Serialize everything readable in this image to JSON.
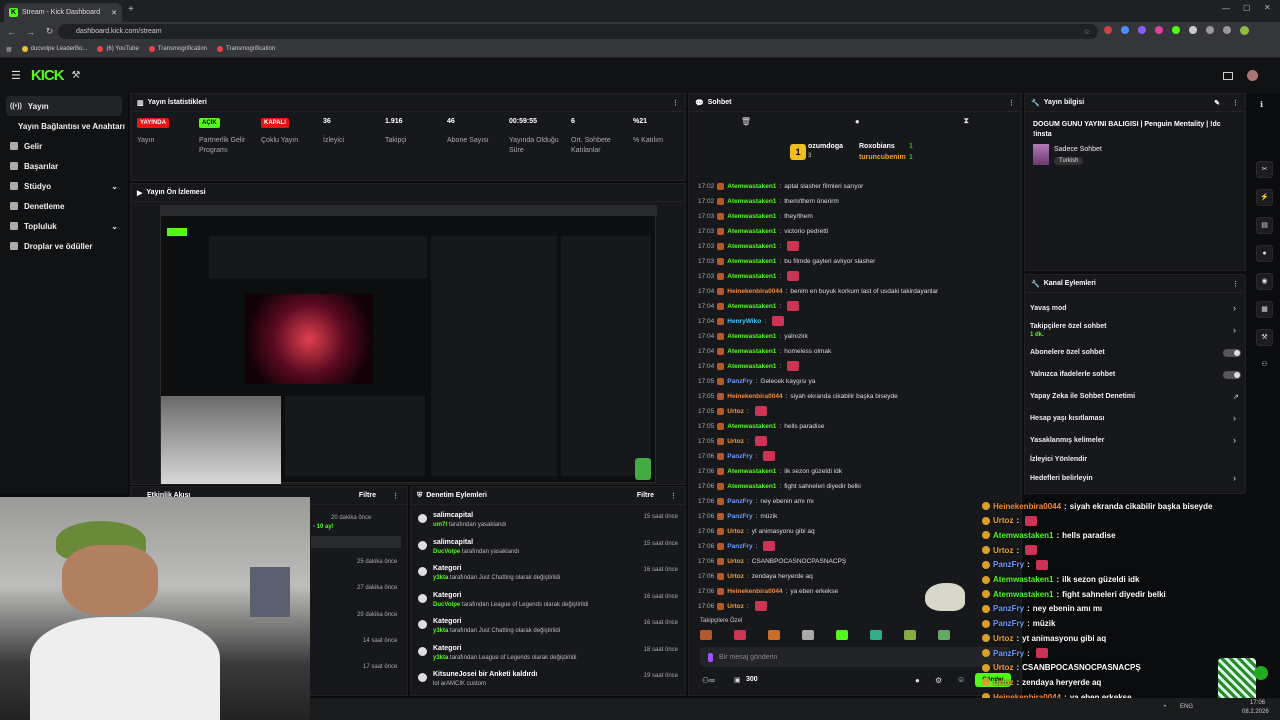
{
  "browser": {
    "tab_title": "Stream - Kick Dashboard",
    "url": "dashboard.kick.com/stream",
    "bookmarks": [
      "ducvolpe LeaderBo...",
      "(6) YouTube",
      "Transmogrification",
      "Transmogrification"
    ]
  },
  "sidebar": {
    "items": [
      "Yayın",
      "Yayın Bağlantısı ve Anahtarı",
      "Gelir",
      "Başarılar",
      "Stüdyo",
      "Denetleme",
      "Topluluk",
      "Droplar ve ödüller"
    ]
  },
  "stats": {
    "title": "Yayın İstatistikleri",
    "items": [
      {
        "value": "YAYINDA",
        "label": "Yayın"
      },
      {
        "value": "AÇIK",
        "label": "Partnerlik Gelir Programı"
      },
      {
        "value": "KAPALI",
        "label": "Çoklu Yayın"
      },
      {
        "value": "36",
        "label": "İzleyici"
      },
      {
        "value": "1.916",
        "label": "Takipçi"
      },
      {
        "value": "46",
        "label": "Abone Sayısı"
      },
      {
        "value": "00:59:55",
        "label": "Yayında Olduğu Süre"
      },
      {
        "value": "6",
        "label": "Ort. Sohbete Katılanlar"
      },
      {
        "value": "%21",
        "label": "% Katılım"
      }
    ]
  },
  "preview": {
    "title": "Yayın Ön İzlemesi"
  },
  "activity": {
    "title": "Etkinlik Akışı",
    "filter": "Filtre",
    "times": [
      "20 dakika önce",
      "25 dakika önce",
      "27 dakika önce",
      "29 dakika önce",
      "14 saat önce",
      "17 saat önce"
    ],
    "ay": "- 10 ay!"
  },
  "moderation": {
    "title": "Denetim Eylemleri",
    "filter": "Filtre",
    "items": [
      {
        "name": "salimcapital",
        "actor": "um7t",
        "desc": "tarafından yasaklandı",
        "time": "15 saat önce"
      },
      {
        "name": "salimcapital",
        "actor": "DucVolpe",
        "desc": "tarafından yasaklandı",
        "time": "15 saat önce"
      },
      {
        "name": "Kategori",
        "actor": "y3kta",
        "desc": "tarafından Just Chatting olarak değiştirildi",
        "time": "16 saat önce"
      },
      {
        "name": "Kategori",
        "actor": "DucVolpe",
        "desc": "tarafından League of Legends olarak değiştirildi",
        "time": "16 saat önce"
      },
      {
        "name": "Kategori",
        "actor": "y3kta",
        "desc": "tarafından Just Chatting olarak değiştirildi",
        "time": "16 saat önce"
      },
      {
        "name": "Kategori",
        "actor": "y3kta",
        "desc": "tarafından League of Legends olarak değiştirildi",
        "time": "18 saat önce"
      },
      {
        "name": "KitsuneJosei bir Anketi kaldırdı",
        "actor": "",
        "desc": "lol arAMCIK custom",
        "time": "19 saat önce"
      }
    ]
  },
  "chat": {
    "title": "Sohbet",
    "pinned": [
      {
        "name": "ozumdoga",
        "count": "3"
      },
      {
        "name": "Roxobians",
        "count": "1"
      },
      {
        "name": "turuncubenim",
        "count": "1"
      }
    ],
    "messages": [
      {
        "t": "17:02",
        "u": "Atemwastaken1",
        "m": "aptal slasher filmleri sarıyor",
        "c": "#53fc18"
      },
      {
        "t": "17:02",
        "u": "Atemwastaken1",
        "m": "them/them önerirm",
        "c": "#53fc18"
      },
      {
        "t": "17:03",
        "u": "Atemwastaken1",
        "m": "they/them",
        "c": "#53fc18"
      },
      {
        "t": "17:03",
        "u": "Atemwastaken1",
        "m": "victorio pedretti",
        "c": "#53fc18"
      },
      {
        "t": "17:03",
        "u": "Atemwastaken1",
        "m": "",
        "c": "#53fc18"
      },
      {
        "t": "17:03",
        "u": "Atemwastaken1",
        "m": "bu filmde gayleri avlıyor slasher",
        "c": "#53fc18"
      },
      {
        "t": "17:03",
        "u": "Atemwastaken1",
        "m": "",
        "c": "#53fc18"
      },
      {
        "t": "17:04",
        "u": "Heinekenbira0044",
        "m": "benim en buyuk korkum last of usdaki takirdayanlar",
        "c": "#f58a3a"
      },
      {
        "t": "17:04",
        "u": "Atemwastaken1",
        "m": "",
        "c": "#53fc18"
      },
      {
        "t": "17:04",
        "u": "HenryWiko",
        "m": "",
        "c": "#40c8ff"
      },
      {
        "t": "17:04",
        "u": "Atemwastaken1",
        "m": "yalnızlık",
        "c": "#53fc18"
      },
      {
        "t": "17:04",
        "u": "Atemwastaken1",
        "m": "homeless olmak",
        "c": "#53fc18"
      },
      {
        "t": "17:04",
        "u": "Atemwastaken1",
        "m": "",
        "c": "#53fc18"
      },
      {
        "t": "17:05",
        "u": "PanzFry",
        "m": "Gelecek kaygısı ya",
        "c": "#6a9cff"
      },
      {
        "t": "17:05",
        "u": "Heinekenbira0044",
        "m": "siyah ekranda cikabilir başka biseyde",
        "c": "#f58a3a"
      },
      {
        "t": "17:05",
        "u": "Urtoz",
        "m": "",
        "c": "#f0a030"
      },
      {
        "t": "17:05",
        "u": "Atemwastaken1",
        "m": "hells paradise",
        "c": "#53fc18"
      },
      {
        "t": "17:05",
        "u": "Urtoz",
        "m": "",
        "c": "#f0a030"
      },
      {
        "t": "17:06",
        "u": "PanzFry",
        "m": "",
        "c": "#6a9cff"
      },
      {
        "t": "17:06",
        "u": "Atemwastaken1",
        "m": "ilk sezon güzeldi idk",
        "c": "#53fc18"
      },
      {
        "t": "17:06",
        "u": "Atemwastaken1",
        "m": "fight sahneleri diyedir belki",
        "c": "#53fc18"
      },
      {
        "t": "17:06",
        "u": "PanzFry",
        "m": "ney ebenin amı mı",
        "c": "#6a9cff"
      },
      {
        "t": "17:06",
        "u": "PanzFry",
        "m": "müzik",
        "c": "#6a9cff"
      },
      {
        "t": "17:06",
        "u": "Urtoz",
        "m": "yt animasyonu gibi aq",
        "c": "#f0a030"
      },
      {
        "t": "17:06",
        "u": "PanzFry",
        "m": "",
        "c": "#6a9cff"
      },
      {
        "t": "17:06",
        "u": "Urtoz",
        "m": "CSANBPOCASNOCPASNACPŞ",
        "c": "#f0a030"
      },
      {
        "t": "17:06",
        "u": "Urtoz",
        "m": "zendaya heryerde aq",
        "c": "#f0a030"
      },
      {
        "t": "17:06",
        "u": "Heinekenbira0044",
        "m": "ya eben erkekse",
        "c": "#f58a3a"
      },
      {
        "t": "17:06",
        "u": "Urtoz",
        "m": "",
        "c": "#f0a030"
      }
    ],
    "followers_only": "Takipçilere Özel",
    "placeholder": "Bir mesaj gönderin",
    "viewers": "300",
    "send": "Gönder"
  },
  "overlay": [
    {
      "u": "Heinekenbira0044",
      "m": "siyah ekranda cikabilir başka biseyde",
      "c": "#f58a3a"
    },
    {
      "u": "Urtoz",
      "m": "",
      "c": "#f0a030"
    },
    {
      "u": "Atemwastaken1",
      "m": "hells paradise",
      "c": "#53fc18"
    },
    {
      "u": "Urtoz",
      "m": "",
      "c": "#f0a030"
    },
    {
      "u": "PanzFry",
      "m": "",
      "c": "#6a9cff"
    },
    {
      "u": "Atemwastaken1",
      "m": "ilk sezon güzeldi idk",
      "c": "#53fc18"
    },
    {
      "u": "Atemwastaken1",
      "m": "fight sahneleri diyedir belki",
      "c": "#53fc18"
    },
    {
      "u": "PanzFry",
      "m": "ney ebenin amı mı",
      "c": "#6a9cff"
    },
    {
      "u": "PanzFry",
      "m": "müzik",
      "c": "#6a9cff"
    },
    {
      "u": "Urtoz",
      "m": "yt animasyonu gibi aq",
      "c": "#f0a030"
    },
    {
      "u": "PanzFry",
      "m": "",
      "c": "#6a9cff"
    },
    {
      "u": "Urtoz",
      "m": "CSANBPOCASNOCPASNACPŞ",
      "c": "#f0a030"
    },
    {
      "u": "Urtoz",
      "m": "zendaya heryerde aq",
      "c": "#f0a030"
    },
    {
      "u": "Heinekenbira0044",
      "m": "ya eben erkekse",
      "c": "#f58a3a"
    },
    {
      "u": "Urtoz",
      "m": "",
      "c": "#f0a030"
    }
  ],
  "streaminfo": {
    "title": "Yayın bilgisi",
    "stream_title": "DOGUM GUNU YAYINI BALIGISI | Penguin Mentality | !dc !insta",
    "category": "Sadece Sohbet",
    "tag": "Turkish"
  },
  "channel": {
    "title": "Kanal Eylemleri",
    "items": [
      "Yavaş mod",
      "Takipçilere özel sohbet",
      "Abonelere özel sohbet",
      "Yalnızca ifadelerle sohbet",
      "Yapay Zeka ile Sohbet Denetimi",
      "Hesap yaşı kısıtlaması",
      "Yasaklanmış kelimeler",
      "İzleyici Yönlendir",
      "Hedefleri belirleyin"
    ],
    "sub": "1 dk."
  },
  "taskbar": {
    "lang": "ENG",
    "time": "17:06",
    "date": "08.2.2026"
  }
}
